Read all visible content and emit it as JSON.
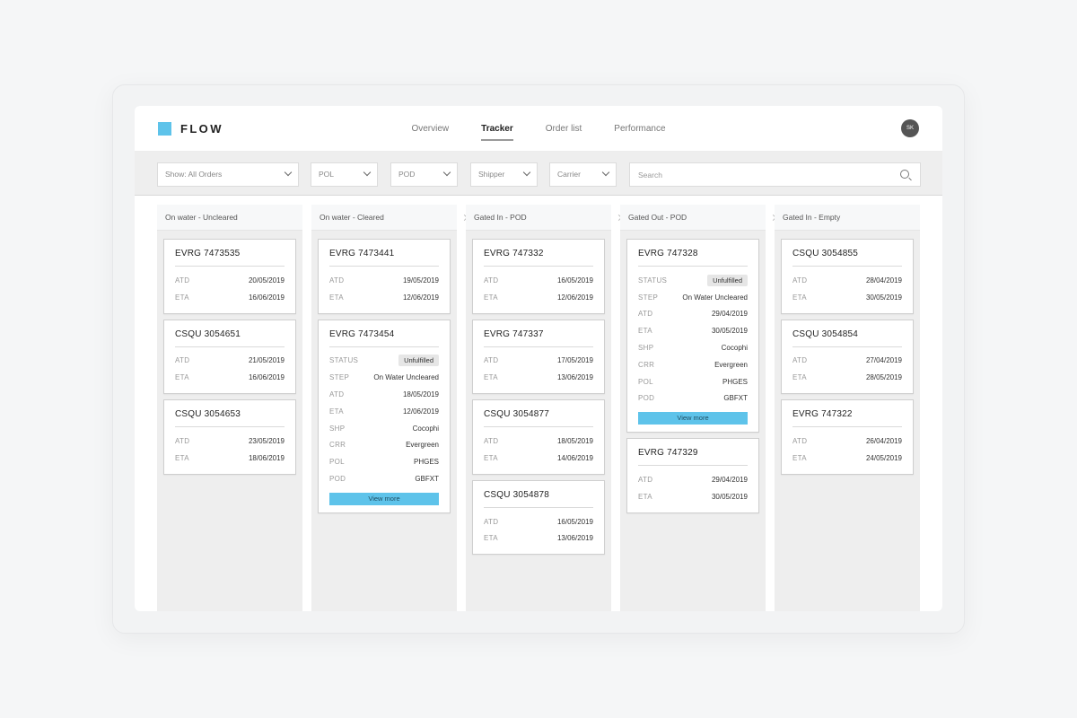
{
  "app": {
    "logo_text": "FLOW",
    "avatar_initials": "SK"
  },
  "nav": [
    {
      "label": "Overview",
      "active": false
    },
    {
      "label": "Tracker",
      "active": true
    },
    {
      "label": "Order list",
      "active": false
    },
    {
      "label": "Performance",
      "active": false
    }
  ],
  "filters": {
    "show": "Show: All Orders",
    "pol": "POL",
    "pod": "POD",
    "shipper": "Shipper",
    "carrier": "Carrier",
    "search_placeholder": "Search"
  },
  "colors": {
    "accent": "#5ec3ea"
  },
  "columns": [
    {
      "title": "On water - Uncleared",
      "cards": [
        {
          "id": "EVRG 7473535",
          "rows": [
            [
              "ATD",
              "20/05/2019"
            ],
            [
              "ETA",
              "16/06/2019"
            ]
          ]
        },
        {
          "id": "CSQU 3054651",
          "rows": [
            [
              "ATD",
              "21/05/2019"
            ],
            [
              "ETA",
              "16/06/2019"
            ]
          ]
        },
        {
          "id": "CSQU 3054653",
          "rows": [
            [
              "ATD",
              "23/05/2019"
            ],
            [
              "ETA",
              "18/06/2019"
            ]
          ]
        }
      ]
    },
    {
      "title": "On water - Cleared",
      "cards": [
        {
          "id": "EVRG 7473441",
          "rows": [
            [
              "ATD",
              "19/05/2019"
            ],
            [
              "ETA",
              "12/06/2019"
            ]
          ]
        },
        {
          "id": "EVRG 7473454",
          "status": "Unfulfilled",
          "rows": [
            [
              "STEP",
              "On Water Uncleared"
            ],
            [
              "ATD",
              "18/05/2019"
            ],
            [
              "ETA",
              "12/06/2019"
            ],
            [
              "SHP",
              "Cocophi"
            ],
            [
              "CRR",
              "Evergreen"
            ],
            [
              "POL",
              "PHGES"
            ],
            [
              "POD",
              "GBFXT"
            ]
          ],
          "view_more": "View more"
        }
      ]
    },
    {
      "title": "Gated In - POD",
      "cards": [
        {
          "id": "EVRG 747332",
          "rows": [
            [
              "ATD",
              "16/05/2019"
            ],
            [
              "ETA",
              "12/06/2019"
            ]
          ]
        },
        {
          "id": "EVRG 747337",
          "rows": [
            [
              "ATD",
              "17/05/2019"
            ],
            [
              "ETA",
              "13/06/2019"
            ]
          ]
        },
        {
          "id": "CSQU 3054877",
          "rows": [
            [
              "ATD",
              "18/05/2019"
            ],
            [
              "ETA",
              "14/06/2019"
            ]
          ]
        },
        {
          "id": "CSQU 3054878",
          "rows": [
            [
              "ATD",
              "16/05/2019"
            ],
            [
              "ETA",
              "13/06/2019"
            ]
          ]
        }
      ]
    },
    {
      "title": "Gated Out - POD",
      "cards": [
        {
          "id": "EVRG 747328",
          "status": "Unfulfilled",
          "rows": [
            [
              "STEP",
              "On Water Uncleared"
            ],
            [
              "ATD",
              "29/04/2019"
            ],
            [
              "ETA",
              "30/05/2019"
            ],
            [
              "SHP",
              "Cocophi"
            ],
            [
              "CRR",
              "Evergreen"
            ],
            [
              "POL",
              "PHGES"
            ],
            [
              "POD",
              "GBFXT"
            ]
          ],
          "view_more": "View more"
        },
        {
          "id": "EVRG 747329",
          "rows": [
            [
              "ATD",
              "29/04/2019"
            ],
            [
              "ETA",
              "30/05/2019"
            ]
          ]
        }
      ]
    },
    {
      "title": "Gated In - Empty",
      "cards": [
        {
          "id": "CSQU 3054855",
          "rows": [
            [
              "ATD",
              "28/04/2019"
            ],
            [
              "ETA",
              "30/05/2019"
            ]
          ]
        },
        {
          "id": "CSQU 3054854",
          "rows": [
            [
              "ATD",
              "27/04/2019"
            ],
            [
              "ETA",
              "28/05/2019"
            ]
          ]
        },
        {
          "id": "EVRG 747322",
          "rows": [
            [
              "ATD",
              "26/04/2019"
            ],
            [
              "ETA",
              "24/05/2019"
            ]
          ]
        }
      ]
    }
  ]
}
